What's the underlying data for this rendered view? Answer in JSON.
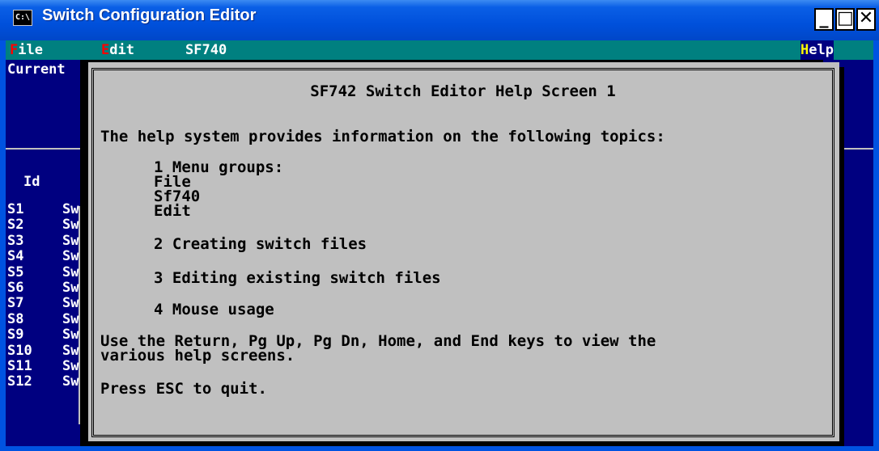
{
  "window": {
    "title": "Switch Configuration Editor",
    "icon_label": "C:\\",
    "buttons": {
      "minimize": "_",
      "maximize": "□",
      "close": "✕"
    }
  },
  "menubar": {
    "items": [
      {
        "hot": "F",
        "rest": "ile"
      },
      {
        "hot": "E",
        "rest": "dit"
      },
      {
        "hot": "",
        "rest": "SF740"
      },
      {
        "hot": "H",
        "rest": "elp"
      }
    ]
  },
  "background": {
    "current_label": "Current",
    "id_header": "Id",
    "ids": [
      "S1",
      "S2",
      "S3",
      "S4",
      "S5",
      "S6",
      "S7",
      "S8",
      "S9",
      "S10",
      "S11",
      "S12"
    ],
    "sw_prefixes": [
      "Sw",
      "Sw",
      "Sw",
      "Sw",
      "Sw",
      "Sw",
      "Sw",
      "Sw",
      "Sw",
      "Sw",
      "Sw",
      "Sw"
    ]
  },
  "help": {
    "title": "SF742 Switch Editor Help Screen 1",
    "intro": "The help system provides information on the following topics:",
    "topics": [
      {
        "label": "1 Menu groups:",
        "subitems": [
          "File",
          "Sf740",
          "Edit"
        ]
      },
      {
        "label": "2 Creating switch files",
        "subitems": []
      },
      {
        "label": "3 Editing existing switch files",
        "subitems": []
      },
      {
        "label": "4 Mouse usage",
        "subitems": []
      }
    ],
    "nav_line1": "Use the Return, Pg Up, Pg Dn, Home, and End keys to view the",
    "nav_line2": "various help screens.",
    "quit": "Press ESC to quit."
  },
  "colors": {
    "title_bar": "#0050db",
    "menu_bar": "#008080",
    "console_bg": "#000000",
    "panel_blue": "#000080",
    "dialog_bg": "#c0c0c0",
    "hotkey_red": "#ff0000",
    "hotkey_yellow": "#ffff00"
  }
}
